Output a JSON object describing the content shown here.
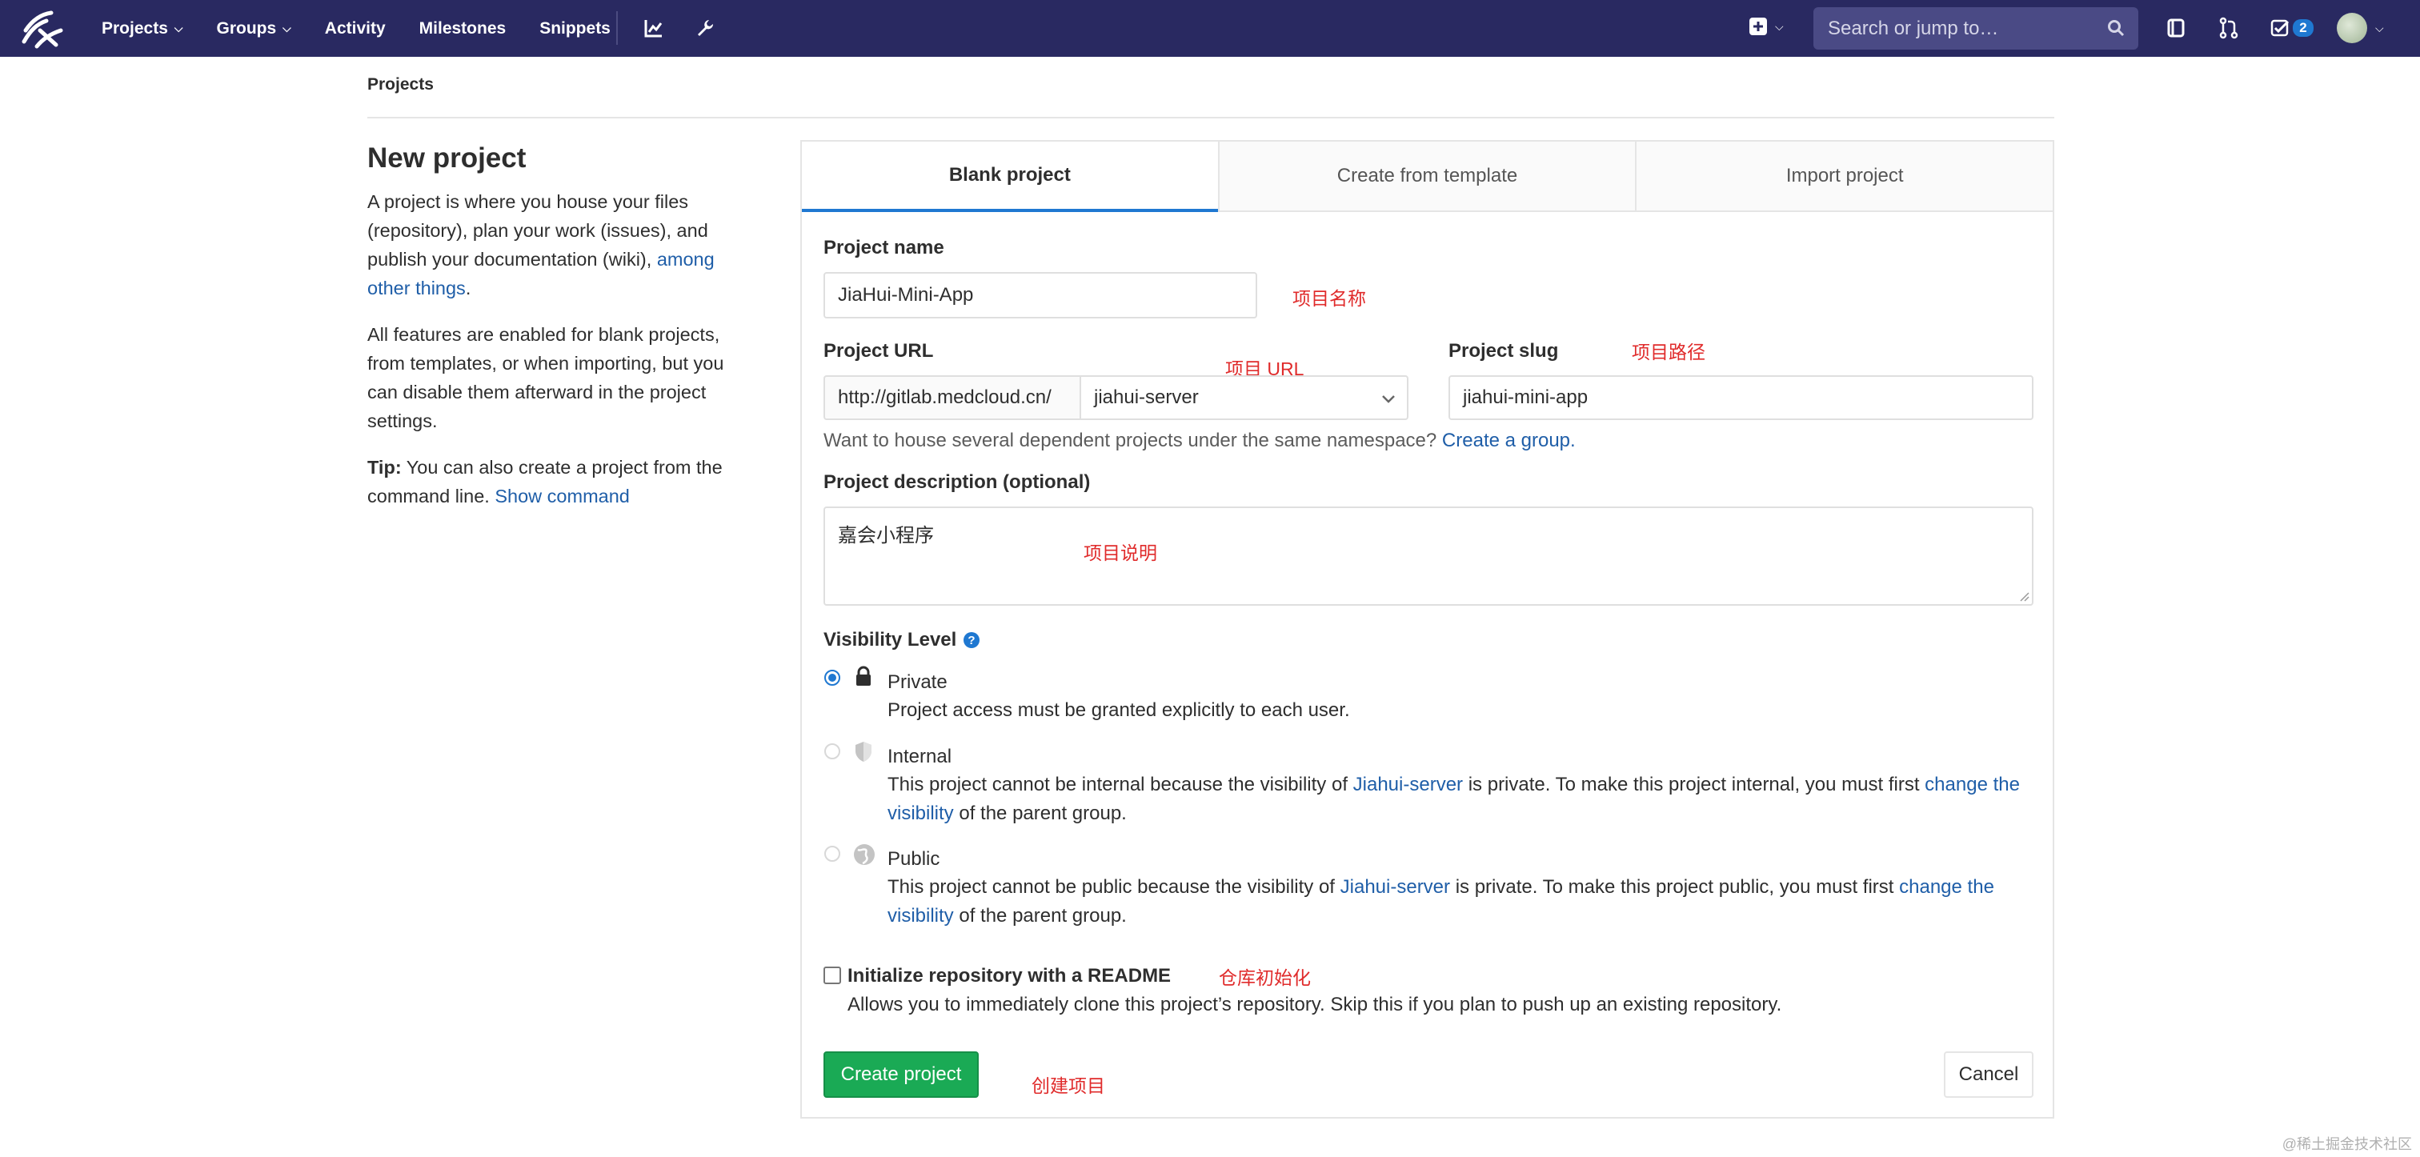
{
  "navbar": {
    "items": [
      {
        "label": "Projects",
        "has_dropdown": true
      },
      {
        "label": "Groups",
        "has_dropdown": true
      },
      {
        "label": "Activity",
        "has_dropdown": false
      },
      {
        "label": "Milestones",
        "has_dropdown": false
      },
      {
        "label": "Snippets",
        "has_dropdown": false
      }
    ],
    "search_placeholder": "Search or jump to…",
    "todo_count": "2",
    "bg_color": "#292961"
  },
  "breadcrumb": "Projects",
  "left": {
    "title": "New project",
    "intro_text": "A project is where you house your files (repository), plan your work (issues), and publish your documentation (wiki), ",
    "intro_link": "among other things",
    "intro_end": ".",
    "features_text": "All features are enabled for blank projects, from templates, or when importing, but you can disable them afterward in the project settings.",
    "tip_label": "Tip:",
    "tip_text": " You can also create a project from the command line. ",
    "tip_link": "Show command"
  },
  "tabs": [
    {
      "label": "Blank project",
      "active": true
    },
    {
      "label": "Create from template",
      "active": false
    },
    {
      "label": "Import project",
      "active": false
    }
  ],
  "form": {
    "project_name_label": "Project name",
    "project_name_value": "JiaHui-Mini-App",
    "project_name_annotation": "项目名称",
    "project_url_label": "Project URL",
    "project_url_annotation": "项目 URL",
    "url_prefix": "http://gitlab.medcloud.cn/",
    "namespace_value": "jiahui-server",
    "project_slug_label": "Project slug",
    "project_slug_annotation": "项目路径",
    "project_slug_value": "jiahui-mini-app",
    "namespace_help": "Want to house several dependent projects under the same namespace? ",
    "namespace_help_link": "Create a group.",
    "description_label": "Project description (optional)",
    "description_value": "嘉会小程序",
    "description_annotation": "项目说明",
    "visibility_label": "Visibility Level",
    "visibility_options": [
      {
        "title": "Private",
        "desc_parts": [
          "Project access must be granted explicitly to each user."
        ],
        "checked": true
      },
      {
        "title": "Internal",
        "desc_a": "This project cannot be internal because the visibility of ",
        "desc_link1": "Jiahui-server",
        "desc_b": " is private. To make this project internal, you must first ",
        "desc_link2": "change the visibility",
        "desc_c": " of the parent group.",
        "checked": false
      },
      {
        "title": "Public",
        "desc_a": "This project cannot be public because the visibility of ",
        "desc_link1": "Jiahui-server",
        "desc_b": " is private. To make this project public, you must first ",
        "desc_link2": "change the visibility",
        "desc_c": " of the parent group.",
        "checked": false
      }
    ],
    "readme_label": "Initialize repository with a README",
    "readme_annotation": "仓库初始化",
    "readme_help": "Allows you to immediately clone this project’s repository. Skip this if you plan to push up an existing repository.",
    "create_button": "Create project",
    "create_annotation": "创建项目",
    "cancel_button": "Cancel"
  },
  "watermark": "@稀土掘金技术社区",
  "colors": {
    "link": "#1f5ea8",
    "primary": "#1aaa55",
    "annotation": "#e02b2b",
    "active_tab": "#1f78d1"
  }
}
